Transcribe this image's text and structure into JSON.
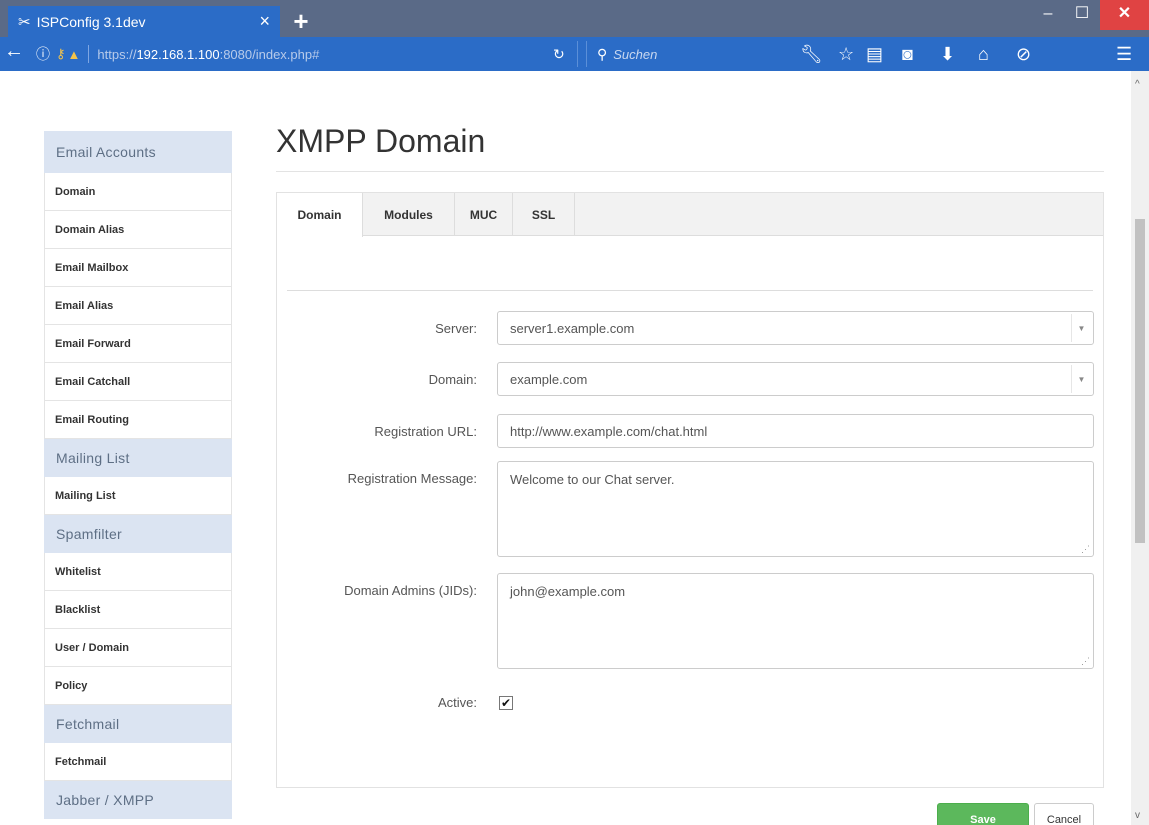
{
  "browser": {
    "tab_title": "ISPConfig 3.1dev",
    "tab_close": "×",
    "new_tab": "+",
    "url_prefix": "https://",
    "url_host": "192.168.1.100",
    "url_rest": ":8080/index.php#",
    "search_placeholder": "Suchen",
    "win_minimize": "–",
    "win_maximize": "☐",
    "win_close": "✕"
  },
  "sidebar": {
    "sections": [
      {
        "title": "Email Accounts",
        "items": [
          "Domain",
          "Domain Alias",
          "Email Mailbox",
          "Email Alias",
          "Email Forward",
          "Email Catchall",
          "Email Routing"
        ]
      },
      {
        "title": "Mailing List",
        "items": [
          "Mailing List"
        ]
      },
      {
        "title": "Spamfilter",
        "items": [
          "Whitelist",
          "Blacklist",
          "User / Domain",
          "Policy"
        ]
      },
      {
        "title": "Fetchmail",
        "items": [
          "Fetchmail"
        ]
      },
      {
        "title": "Jabber / XMPP",
        "items": []
      }
    ]
  },
  "main": {
    "title": "XMPP Domain",
    "tabs": [
      {
        "label": "Domain",
        "active": true
      },
      {
        "label": "Modules",
        "active": false
      },
      {
        "label": "MUC",
        "active": false
      },
      {
        "label": "SSL",
        "active": false
      }
    ],
    "form": {
      "server_label": "Server:",
      "server_value": "server1.example.com",
      "domain_label": "Domain:",
      "domain_value": "example.com",
      "reg_url_label": "Registration URL:",
      "reg_url_value": "http://www.example.com/chat.html",
      "reg_msg_label": "Registration Message:",
      "reg_msg_value": "Welcome to our Chat server.",
      "admins_label": "Domain Admins (JIDs):",
      "admins_value": "john@example.com",
      "active_label": "Active:",
      "active_checked": true
    },
    "buttons": {
      "save": "Save",
      "cancel": "Cancel"
    }
  },
  "colors": {
    "browser_blue": "#2b6cc7",
    "sidebar_header_bg": "#dbe4f2",
    "save_green": "#5cb85c"
  }
}
